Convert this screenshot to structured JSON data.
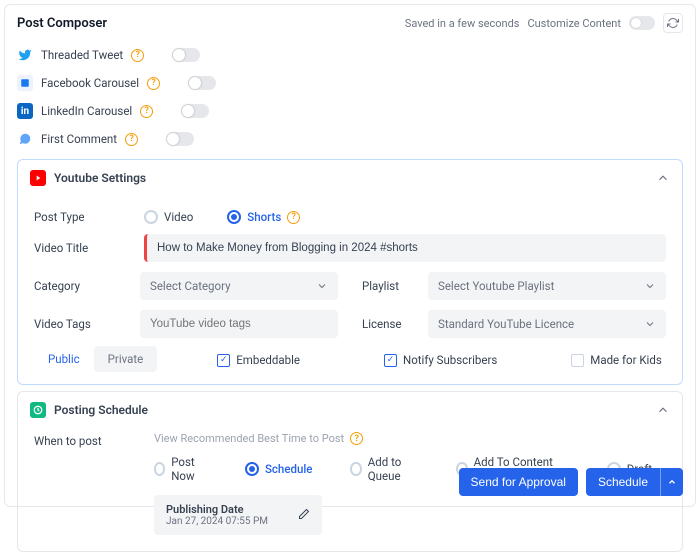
{
  "header": {
    "title": "Post Composer",
    "saved": "Saved in a few seconds",
    "customize": "Customize Content"
  },
  "options": {
    "threaded": "Threaded Tweet",
    "fbcarousel": "Facebook Carousel",
    "licarousel": "LinkedIn Carousel",
    "firstcomment": "First Comment"
  },
  "youtube": {
    "title": "Youtube Settings",
    "postTypeLabel": "Post Type",
    "video": "Video",
    "shorts": "Shorts",
    "videoTitleLabel": "Video Title",
    "videoTitleValue": "How to Make Money from Blogging in 2024 #shorts",
    "categoryLabel": "Category",
    "categoryPlaceholder": "Select Category",
    "tagsLabel": "Video Tags",
    "tagsPlaceholder": "YouTube video tags",
    "playlistLabel": "Playlist",
    "playlistPlaceholder": "Select Youtube Playlist",
    "licenseLabel": "License",
    "licenseValue": "Standard YouTube Licence",
    "public": "Public",
    "private": "Private",
    "embeddable": "Embeddable",
    "notify": "Notify Subscribers",
    "kids": "Made for Kids"
  },
  "schedule": {
    "title": "Posting Schedule",
    "whenLabel": "When to post",
    "reco": "View Recommended Best Time to Post",
    "postNow": "Post Now",
    "schedule": "Schedule",
    "queue": "Add to Queue",
    "category": "Add To Content Category",
    "draft": "Draft",
    "publishing": "Publishing Date",
    "date": "Jan 27, 2024 07:55 PM"
  },
  "footer": {
    "approval": "Send for Approval",
    "schedule": "Schedule"
  }
}
